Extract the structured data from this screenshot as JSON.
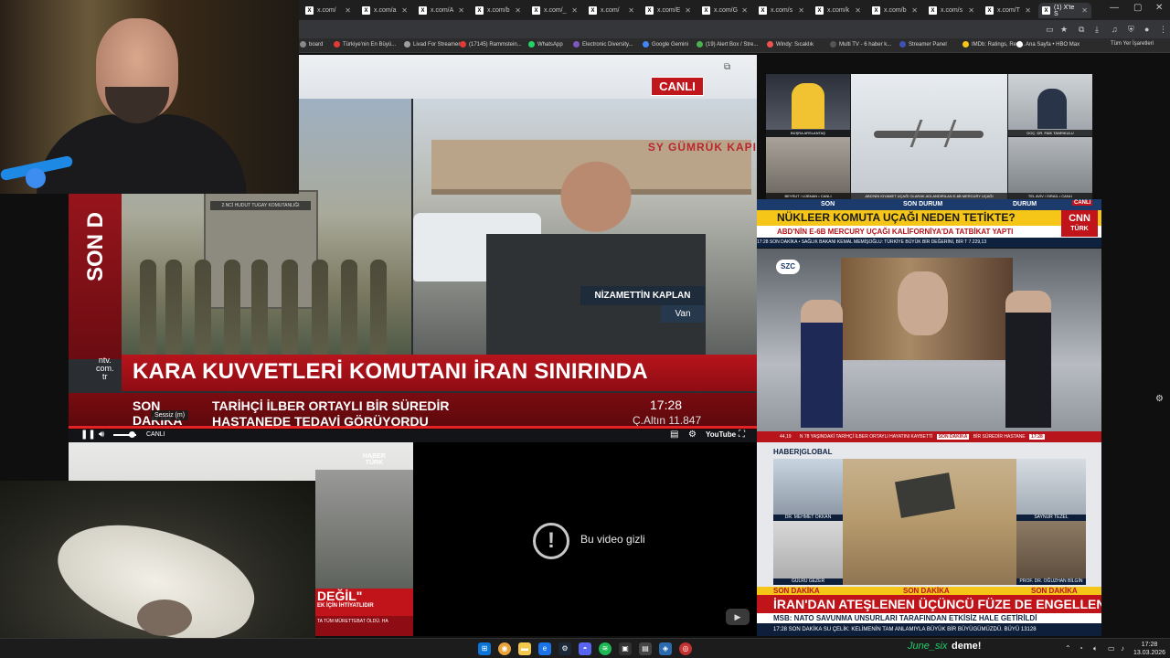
{
  "browser": {
    "tabs": [
      {
        "title": "x.com/",
        "favicon": "X"
      },
      {
        "title": "x.com/a",
        "favicon": "X"
      },
      {
        "title": "x.com/A",
        "favicon": "X"
      },
      {
        "title": "x.com/b",
        "favicon": "X"
      },
      {
        "title": "x.com/_",
        "favicon": "X"
      },
      {
        "title": "x.com/",
        "favicon": "X"
      },
      {
        "title": "x.com/E",
        "favicon": "X"
      },
      {
        "title": "x.com/G",
        "favicon": "X"
      },
      {
        "title": "x.com/s",
        "favicon": "X"
      },
      {
        "title": "x.com/k",
        "favicon": "X"
      },
      {
        "title": "x.com/b",
        "favicon": "X"
      },
      {
        "title": "x.com/s",
        "favicon": "X"
      },
      {
        "title": "x.com/T",
        "favicon": "X"
      },
      {
        "title": "(1) X'te S",
        "favicon": "X",
        "active": true
      }
    ],
    "new_tab": "+",
    "window_controls": {
      "minimize": "—",
      "maximize": "▢",
      "close": "✕"
    },
    "bookmarks": [
      {
        "label": "board",
        "color": "#888"
      },
      {
        "label": "Türkiye'nin En Büyü...",
        "color": "#e53935"
      },
      {
        "label": "Livad For Streamers",
        "color": "#9e9e9e"
      },
      {
        "label": "(17145) Rammstein...",
        "color": "#e53935"
      },
      {
        "label": "WhatsApp",
        "color": "#25d366"
      },
      {
        "label": "Electronic Diversity...",
        "color": "#7e57c2"
      },
      {
        "label": "Google Gemini",
        "color": "#4285f4"
      },
      {
        "label": "(19) Alert Box / Stre...",
        "color": "#4caf50"
      },
      {
        "label": "Windy: Sıcaklık",
        "color": "#ef5350"
      },
      {
        "label": "Multi TV - 6 haber k...",
        "color": "#555"
      },
      {
        "label": "Streamer Panel",
        "color": "#3f51b5"
      },
      {
        "label": "IMDb: Ratings, Revi...",
        "color": "#f5c518"
      },
      {
        "label": "Ana Sayfa • HBO Max",
        "color": "#ffffff"
      }
    ],
    "other_bookmarks": "Tüm Yer İşaretleri"
  },
  "main_video": {
    "live_badge": "CANLI",
    "side_label": "SON D",
    "channel_logo": [
      "ntv.",
      "com.",
      "tr"
    ],
    "sign_text": "2.NCİ HUDUT TUGAY KOMUTANLIĞI",
    "gate_text": "SY GÜMRÜK KAPI",
    "reporter_name": "NİZAMETTİN KAPLAN",
    "reporter_location": "Van",
    "headline": "KARA KUVVETLERİ KOMUTANI İRAN SINIRINDA",
    "ticker_label": [
      "SON",
      "DAKİKA"
    ],
    "ticker_text": [
      "TARİHÇİ İLBER ORTAYLI BİR SÜREDİR",
      "HASTANEDE TEDAVİ GÖRÜYORDU"
    ],
    "clock": "17:28",
    "gold": "Ç.Altın 11.847",
    "player": {
      "mute_tooltip": "Sessiz (m)",
      "live_label": "CANLI",
      "youtube_label": "YouTube",
      "volume_level": 0.8
    }
  },
  "right_top": {
    "captions": [
      "BÜŞRA ARSLANTAŞ",
      "ABD'NİN KIYAMET UÇAĞI OLARAK ADLANDIRILAN E-6B MERCURY UÇAĞI",
      "DOÇ. DR. FAİK TANRIKULU",
      "BEYRUT / LÜBNAN • CANLI",
      "TEL AVİV / İSRAİL • CANLI"
    ],
    "top_labels": [
      "SON",
      "SON DURUM",
      "DURUM"
    ],
    "live_tag": "CANLI",
    "headline": "NÜKLEER KOMUTA UÇAĞI NEDEN TETİKTE?",
    "sub": "ABD'NİN E-6B MERCURY UÇAĞI KALİFORNİYA'DA TATBİKAT YAPTI",
    "ticker": "17:28   SON DAKİKA   • SAĞLIK BAKANI KEMAL MEMİŞOĞLU: TÜRKİYE BÜYÜK BİR DEĞERİNİ, BİR T   7.229,13",
    "logo": [
      "CNN",
      "TÜRK"
    ]
  },
  "szc": {
    "logo": "SZC",
    "ticker_left": "44,19",
    "ticker_mid": "N 78 YAŞINDAKİ TARİHÇİ İLBER ORTAYLI HAYATINI KAYBETTİ",
    "ticker_badge": "SON DAKİKA",
    "ticker_right": "BİR SÜREDİR HASTANE",
    "ticker_time": "17:28"
  },
  "haber_global": {
    "logo": "HABER|GLOBAL",
    "guests": [
      {
        "name": "DR. MEHMET OKKAN",
        "title": "EMEKLİ TÜMGENERAL"
      },
      {
        "name": "SAYNUR TEZEL",
        "title": ""
      },
      {
        "name": "GÜLRU GEZER",
        "title": ""
      },
      {
        "name": "PROF. DR. OĞUZHAN BİLGİN",
        "title": "SİYASET BİLİMCİ"
      }
    ],
    "sd_labels": [
      "SON DAKİKA",
      "SON DAKİKA",
      "SON DAKİKA"
    ],
    "headline": "İRAN'DAN ATEŞLENEN ÜÇÜNCÜ FÜZE DE ENGELLENDİ",
    "sub": "MSB: NATO SAVUNMA UNSURLARI TARAFINDAN ETKİSİZ HALE GETİRİLDİ",
    "ticker": "17:28   SON DAKİKA SU ÇELİK: KELİMENİN TAM ANLAMIYLA BÜYÜK BİR BÜYÜGÜMÜZDÜ. BÜYÜ   13128"
  },
  "haberturk": {
    "logo": [
      "HABER",
      "TÜRK"
    ],
    "banner": "DEĞİL\"",
    "banner_sub": "EK İÇİN İHTİYATLIDIR",
    "bottom": "TA TÜM MÜRETTEBAT ÖLDÜ. HA"
  },
  "private_video": {
    "icon": "!",
    "message": "Bu video gizli"
  },
  "taskbar": {
    "chat_user": "June_six",
    "chat_message": "deme!",
    "time": "17:28",
    "date": "13.03.2026"
  }
}
